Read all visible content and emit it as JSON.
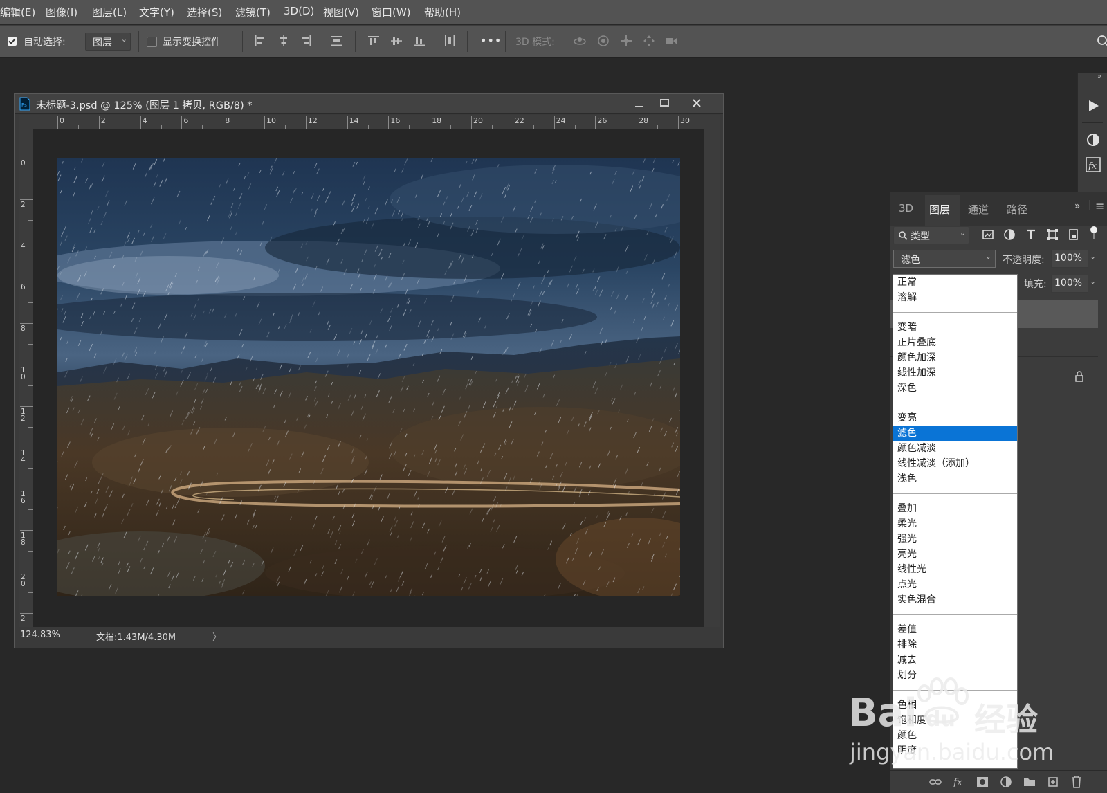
{
  "menu": [
    "编辑(E)",
    "图像(I)",
    "图层(L)",
    "文字(Y)",
    "选择(S)",
    "滤镜(T)",
    "3D(D)",
    "视图(V)",
    "窗口(W)",
    "帮助(H)"
  ],
  "options": {
    "auto_select_label": "自动选择:",
    "auto_select_checked": true,
    "auto_select_value": "图层",
    "show_transform_label": "显示变换控件",
    "show_transform_checked": false,
    "mode_3d_label": "3D 模式:",
    "more_label": "•••"
  },
  "document": {
    "title": "未标题-3.psd @ 125% (图层 1 拷贝, RGB/8) *",
    "ruler_h": [
      "0",
      "2",
      "4",
      "6",
      "8",
      "10",
      "12",
      "14",
      "16",
      "18",
      "20",
      "22",
      "24",
      "26",
      "28",
      "30"
    ],
    "ruler_v": [
      "0",
      "2",
      "4",
      "6",
      "8",
      "1\n0",
      "1\n2",
      "1\n4",
      "1\n6",
      "1\n8",
      "2\n0",
      "2"
    ],
    "zoom": "124.83%",
    "doc_size": "文档:1.43M/4.30M",
    "status_arrow": "〉"
  },
  "panel": {
    "tabs": [
      "3D",
      "图层",
      "通道",
      "路径"
    ],
    "active_tab": "图层",
    "filter_label": "类型",
    "blend_mode": "滤色",
    "opacity_label": "不透明度:",
    "opacity_value": "100%",
    "fill_label": "填充:",
    "fill_value": "100%"
  },
  "blend_modes": {
    "groups": [
      [
        "正常",
        "溶解"
      ],
      [
        "变暗",
        "正片叠底",
        "颜色加深",
        "线性加深",
        "深色"
      ],
      [
        "变亮",
        "滤色",
        "颜色减淡",
        "线性减淡（添加）",
        "浅色"
      ],
      [
        "叠加",
        "柔光",
        "强光",
        "亮光",
        "线性光",
        "点光",
        "实色混合"
      ],
      [
        "差值",
        "排除",
        "减去",
        "划分"
      ],
      [
        "色相",
        "饱和度",
        "颜色",
        "明度"
      ]
    ],
    "selected": "滤色"
  },
  "watermark": {
    "brand": "Bai",
    "brand_suffix": "du",
    "cn": "经验",
    "url": "jingyan.baidu.com"
  },
  "colors": {
    "selected": "#0a74d6",
    "ui_bg": "#535353",
    "workspace": "#282828"
  }
}
